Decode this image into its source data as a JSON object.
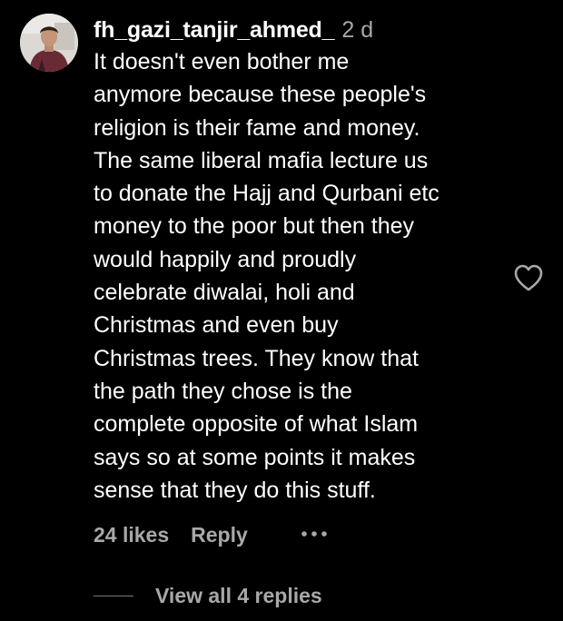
{
  "comment": {
    "username": "fh_gazi_tanjir_ahmed_",
    "timestamp": "2 d",
    "text_lines": [
      "It doesn't even bother me",
      "anymore because these people's",
      "religion is their fame and money.",
      "The same liberal mafia lecture us",
      "to donate the Hajj and Qurbani etc",
      "money to the poor but then they",
      "would happily and proudly",
      "celebrate diwalai, holi and",
      "Christmas and even buy",
      "Christmas trees. They know that",
      "the path they chose is the",
      "complete opposite of what Islam",
      "says so at some points it makes",
      "sense that they do this stuff."
    ],
    "likes": "24 likes",
    "reply_label": "Reply",
    "more_icon": "ellipsis-icon",
    "like_icon": "heart-outline-icon",
    "avatar_icon": "user-avatar"
  },
  "replies": {
    "view_label": "View all 4 replies"
  },
  "colors": {
    "background": "#000000",
    "primary_text": "#ffffff",
    "secondary_text": "#a8a8a8"
  }
}
